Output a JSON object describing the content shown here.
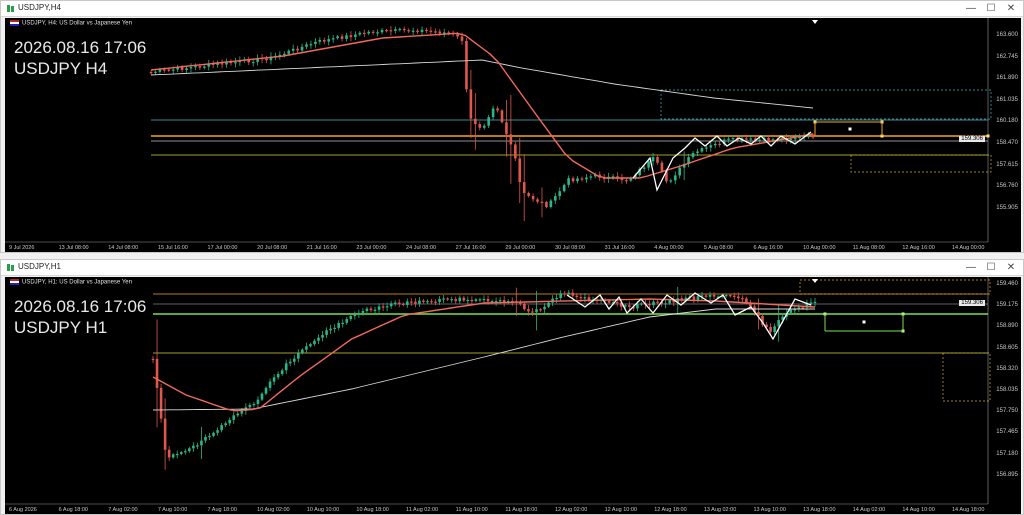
{
  "colors": {
    "bull": "#2db58a",
    "bear": "#e0574e",
    "ma_fast": "#f06a5a",
    "ma_slow": "#d8d8d8",
    "zigzag": "#ffffff",
    "level_blue": "#4fb7c8",
    "level_orange": "#f5a623",
    "level_yellow": "#d8d640",
    "level_green": "#7be04c",
    "box_dotted_cyan": "#3fb6c6",
    "box_dotted_yellow": "#c8b82a"
  },
  "window_h4": {
    "title": "USDJPY,H4",
    "symbol_header": "USDJPY, H4: US Dollar vs Japanese Yen",
    "overlay_time": "2026.08.16 17:06",
    "overlay_symbol": "USDJPY H4",
    "current_price_tag": "159.306",
    "price_labels": [
      "163.600",
      "162.745",
      "161.890",
      "161.035",
      "160.180",
      "158.470",
      "157.615",
      "156.760",
      "155.905"
    ],
    "time_labels": [
      "9 Jul 2026",
      "13 Jul 08:00",
      "14 Jul 08:00",
      "15 Jul 16:00",
      "17 Jul 00:00",
      "20 Jul 08:00",
      "21 Jul 16:00",
      "23 Jul 00:00",
      "24 Jul 08:00",
      "27 Jul 16:00",
      "29 Jul 00:00",
      "30 Jul 08:00",
      "31 Jul 16:00",
      "4 Aug 00:00",
      "5 Aug 08:00",
      "6 Aug 16:00",
      "10 Aug 00:00",
      "11 Aug 08:00",
      "12 Aug 16:00",
      "14 Aug 00:00"
    ]
  },
  "window_h1": {
    "title": "USDJPY,H1",
    "symbol_header": "USDJPY, H1: US Dollar vs Japanese Yen",
    "overlay_time": "2026.08.16 17:06",
    "overlay_symbol": "USDJPY H1",
    "current_price_tag": "159.306",
    "price_labels": [
      "159.460",
      "159.175",
      "158.890",
      "158.605",
      "158.320",
      "158.035",
      "157.750",
      "157.465",
      "157.180",
      "156.895"
    ],
    "time_labels": [
      "6 Aug 2026",
      "6 Aug 18:00",
      "7 Aug 02:00",
      "7 Aug 10:00",
      "7 Aug 18:00",
      "10 Aug 02:00",
      "10 Aug 10:00",
      "10 Aug 18:00",
      "11 Aug 02:00",
      "11 Aug 10:00",
      "11 Aug 18:00",
      "12 Aug 02:00",
      "12 Aug 10:00",
      "12 Aug 18:00",
      "13 Aug 02:00",
      "13 Aug 10:00",
      "13 Aug 18:00",
      "14 Aug 02:00",
      "14 Aug 10:00",
      "14 Aug 18:00"
    ]
  },
  "window_controls": {
    "minimize": "—",
    "maximize": "☐",
    "close": "✕"
  }
}
